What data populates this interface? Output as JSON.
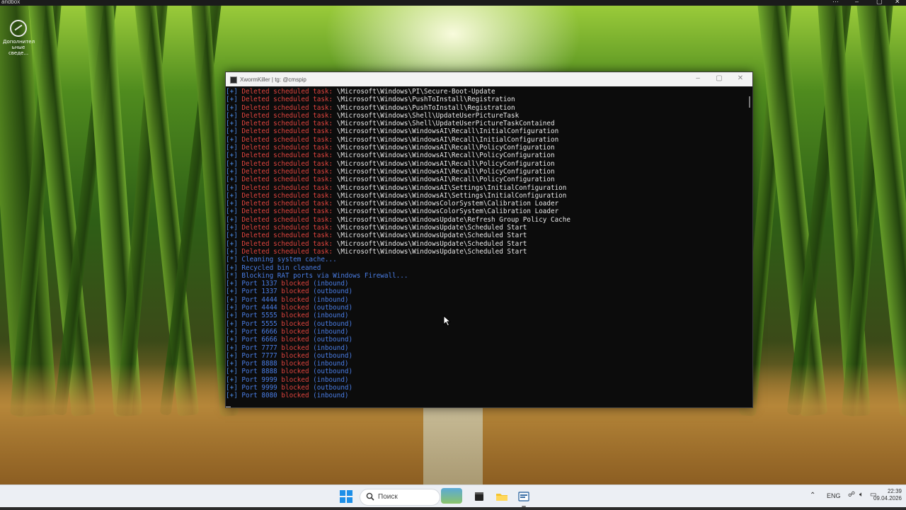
{
  "sandbox": {
    "title": "andbox",
    "controls": [
      "⋯",
      "–",
      "▢",
      "✕"
    ]
  },
  "desktop_icon": {
    "label_line1": "Дополнител",
    "label_line2": "ьные сведе..."
  },
  "console": {
    "window_title": "XwormKiller | tg: @cmspip",
    "lines": [
      {
        "prefix": "[+]",
        "parts": [
          {
            "t": " Deleted scheduled task: ",
            "c": "red"
          },
          {
            "t": "\\Microsoft\\Windows\\PI\\Secure-Boot-Update",
            "c": "white"
          }
        ]
      },
      {
        "prefix": "[+]",
        "parts": [
          {
            "t": " Deleted scheduled task: ",
            "c": "red"
          },
          {
            "t": "\\Microsoft\\Windows\\PushToInstall\\Registration",
            "c": "white"
          }
        ]
      },
      {
        "prefix": "[+]",
        "parts": [
          {
            "t": " Deleted scheduled task: ",
            "c": "red"
          },
          {
            "t": "\\Microsoft\\Windows\\PushToInstall\\Registration",
            "c": "white"
          }
        ]
      },
      {
        "prefix": "[+]",
        "parts": [
          {
            "t": " Deleted scheduled task: ",
            "c": "red"
          },
          {
            "t": "\\Microsoft\\Windows\\Shell\\UpdateUserPictureTask",
            "c": "white"
          }
        ]
      },
      {
        "prefix": "[+]",
        "parts": [
          {
            "t": " Deleted scheduled task: ",
            "c": "red"
          },
          {
            "t": "\\Microsoft\\Windows\\Shell\\UpdateUserPictureTaskContained",
            "c": "white"
          }
        ]
      },
      {
        "prefix": "[+]",
        "parts": [
          {
            "t": " Deleted scheduled task: ",
            "c": "red"
          },
          {
            "t": "\\Microsoft\\Windows\\WindowsAI\\Recall\\InitialConfiguration",
            "c": "white"
          }
        ]
      },
      {
        "prefix": "[+]",
        "parts": [
          {
            "t": " Deleted scheduled task: ",
            "c": "red"
          },
          {
            "t": "\\Microsoft\\Windows\\WindowsAI\\Recall\\InitialConfiguration",
            "c": "white"
          }
        ]
      },
      {
        "prefix": "[+]",
        "parts": [
          {
            "t": " Deleted scheduled task: ",
            "c": "red"
          },
          {
            "t": "\\Microsoft\\Windows\\WindowsAI\\Recall\\PolicyConfiguration",
            "c": "white"
          }
        ]
      },
      {
        "prefix": "[+]",
        "parts": [
          {
            "t": " Deleted scheduled task: ",
            "c": "red"
          },
          {
            "t": "\\Microsoft\\Windows\\WindowsAI\\Recall\\PolicyConfiguration",
            "c": "white"
          }
        ]
      },
      {
        "prefix": "[+]",
        "parts": [
          {
            "t": " Deleted scheduled task: ",
            "c": "red"
          },
          {
            "t": "\\Microsoft\\Windows\\WindowsAI\\Recall\\PolicyConfiguration",
            "c": "white"
          }
        ]
      },
      {
        "prefix": "[+]",
        "parts": [
          {
            "t": " Deleted scheduled task: ",
            "c": "red"
          },
          {
            "t": "\\Microsoft\\Windows\\WindowsAI\\Recall\\PolicyConfiguration",
            "c": "white"
          }
        ]
      },
      {
        "prefix": "[+]",
        "parts": [
          {
            "t": " Deleted scheduled task: ",
            "c": "red"
          },
          {
            "t": "\\Microsoft\\Windows\\WindowsAI\\Recall\\PolicyConfiguration",
            "c": "white"
          }
        ]
      },
      {
        "prefix": "[+]",
        "parts": [
          {
            "t": " Deleted scheduled task: ",
            "c": "red"
          },
          {
            "t": "\\Microsoft\\Windows\\WindowsAI\\Settings\\InitialConfiguration",
            "c": "white"
          }
        ]
      },
      {
        "prefix": "[+]",
        "parts": [
          {
            "t": " Deleted scheduled task: ",
            "c": "red"
          },
          {
            "t": "\\Microsoft\\Windows\\WindowsAI\\Settings\\InitialConfiguration",
            "c": "white"
          }
        ]
      },
      {
        "prefix": "[+]",
        "parts": [
          {
            "t": " Deleted scheduled task: ",
            "c": "red"
          },
          {
            "t": "\\Microsoft\\Windows\\WindowsColorSystem\\Calibration Loader",
            "c": "white"
          }
        ]
      },
      {
        "prefix": "[+]",
        "parts": [
          {
            "t": " Deleted scheduled task: ",
            "c": "red"
          },
          {
            "t": "\\Microsoft\\Windows\\WindowsColorSystem\\Calibration Loader",
            "c": "white"
          }
        ]
      },
      {
        "prefix": "[+]",
        "parts": [
          {
            "t": " Deleted scheduled task: ",
            "c": "red"
          },
          {
            "t": "\\Microsoft\\Windows\\WindowsUpdate\\Refresh Group Policy Cache",
            "c": "white"
          }
        ]
      },
      {
        "prefix": "[+]",
        "parts": [
          {
            "t": " Deleted scheduled task: ",
            "c": "red"
          },
          {
            "t": "\\Microsoft\\Windows\\WindowsUpdate\\Scheduled Start",
            "c": "white"
          }
        ]
      },
      {
        "prefix": "[+]",
        "parts": [
          {
            "t": " Deleted scheduled task: ",
            "c": "red"
          },
          {
            "t": "\\Microsoft\\Windows\\WindowsUpdate\\Scheduled Start",
            "c": "white"
          }
        ]
      },
      {
        "prefix": "[+]",
        "parts": [
          {
            "t": " Deleted scheduled task: ",
            "c": "red"
          },
          {
            "t": "\\Microsoft\\Windows\\WindowsUpdate\\Scheduled Start",
            "c": "white"
          }
        ]
      },
      {
        "prefix": "[+]",
        "parts": [
          {
            "t": " Deleted scheduled task: ",
            "c": "red"
          },
          {
            "t": "\\Microsoft\\Windows\\WindowsUpdate\\Scheduled Start",
            "c": "white"
          }
        ]
      },
      {
        "prefix": "[*]",
        "parts": [
          {
            "t": " Cleaning system cache...",
            "c": "blue"
          }
        ]
      },
      {
        "prefix": "[+]",
        "parts": [
          {
            "t": " Recycled bin cleaned",
            "c": "blue"
          }
        ]
      },
      {
        "prefix": "[*]",
        "parts": [
          {
            "t": " Blocking RAT ports via Windows Firewall...",
            "c": "blue"
          }
        ]
      },
      {
        "prefix": "[+]",
        "parts": [
          {
            "t": " Port 1337 ",
            "c": "blue"
          },
          {
            "t": "blocked ",
            "c": "red"
          },
          {
            "t": "(inbound)",
            "c": "blue"
          }
        ]
      },
      {
        "prefix": "[+]",
        "parts": [
          {
            "t": " Port 1337 ",
            "c": "blue"
          },
          {
            "t": "blocked ",
            "c": "red"
          },
          {
            "t": "(outbound)",
            "c": "blue"
          }
        ]
      },
      {
        "prefix": "[+]",
        "parts": [
          {
            "t": " Port 4444 ",
            "c": "blue"
          },
          {
            "t": "blocked ",
            "c": "red"
          },
          {
            "t": "(inbound)",
            "c": "blue"
          }
        ]
      },
      {
        "prefix": "[+]",
        "parts": [
          {
            "t": " Port 4444 ",
            "c": "blue"
          },
          {
            "t": "blocked ",
            "c": "red"
          },
          {
            "t": "(outbound)",
            "c": "blue"
          }
        ]
      },
      {
        "prefix": "[+]",
        "parts": [
          {
            "t": " Port 5555 ",
            "c": "blue"
          },
          {
            "t": "blocked ",
            "c": "red"
          },
          {
            "t": "(inbound)",
            "c": "blue"
          }
        ]
      },
      {
        "prefix": "[+]",
        "parts": [
          {
            "t": " Port 5555 ",
            "c": "blue"
          },
          {
            "t": "blocked ",
            "c": "red"
          },
          {
            "t": "(outbound)",
            "c": "blue"
          }
        ]
      },
      {
        "prefix": "[+]",
        "parts": [
          {
            "t": " Port 6666 ",
            "c": "blue"
          },
          {
            "t": "blocked ",
            "c": "red"
          },
          {
            "t": "(inbound)",
            "c": "blue"
          }
        ]
      },
      {
        "prefix": "[+]",
        "parts": [
          {
            "t": " Port 6666 ",
            "c": "blue"
          },
          {
            "t": "blocked ",
            "c": "red"
          },
          {
            "t": "(outbound)",
            "c": "blue"
          }
        ]
      },
      {
        "prefix": "[+]",
        "parts": [
          {
            "t": " Port 7777 ",
            "c": "blue"
          },
          {
            "t": "blocked ",
            "c": "red"
          },
          {
            "t": "(inbound)",
            "c": "blue"
          }
        ]
      },
      {
        "prefix": "[+]",
        "parts": [
          {
            "t": " Port 7777 ",
            "c": "blue"
          },
          {
            "t": "blocked ",
            "c": "red"
          },
          {
            "t": "(outbound)",
            "c": "blue"
          }
        ]
      },
      {
        "prefix": "[+]",
        "parts": [
          {
            "t": " Port 8888 ",
            "c": "blue"
          },
          {
            "t": "blocked ",
            "c": "red"
          },
          {
            "t": "(inbound)",
            "c": "blue"
          }
        ]
      },
      {
        "prefix": "[+]",
        "parts": [
          {
            "t": " Port 8888 ",
            "c": "blue"
          },
          {
            "t": "blocked ",
            "c": "red"
          },
          {
            "t": "(outbound)",
            "c": "blue"
          }
        ]
      },
      {
        "prefix": "[+]",
        "parts": [
          {
            "t": " Port 9999 ",
            "c": "blue"
          },
          {
            "t": "blocked ",
            "c": "red"
          },
          {
            "t": "(inbound)",
            "c": "blue"
          }
        ]
      },
      {
        "prefix": "[+]",
        "parts": [
          {
            "t": " Port 9999 ",
            "c": "blue"
          },
          {
            "t": "blocked ",
            "c": "red"
          },
          {
            "t": "(outbound)",
            "c": "blue"
          }
        ]
      },
      {
        "prefix": "[+]",
        "parts": [
          {
            "t": " Port 8080 ",
            "c": "blue"
          },
          {
            "t": "blocked ",
            "c": "red"
          },
          {
            "t": "(inbound)",
            "c": "blue"
          }
        ]
      }
    ]
  },
  "taskbar": {
    "search_placeholder": "Поиск",
    "language": "ENG",
    "time": "22:39",
    "date": "09.04.2026",
    "apps": [
      "start-icon",
      "search-icon",
      "widget-icon",
      "terminal-icon",
      "folder-icon",
      "app-icon"
    ]
  },
  "colors": {
    "red": "#e0443e",
    "blue": "#4a7ee6",
    "console_bg": "#0c0c0c",
    "accent": "#1d8fe8"
  }
}
